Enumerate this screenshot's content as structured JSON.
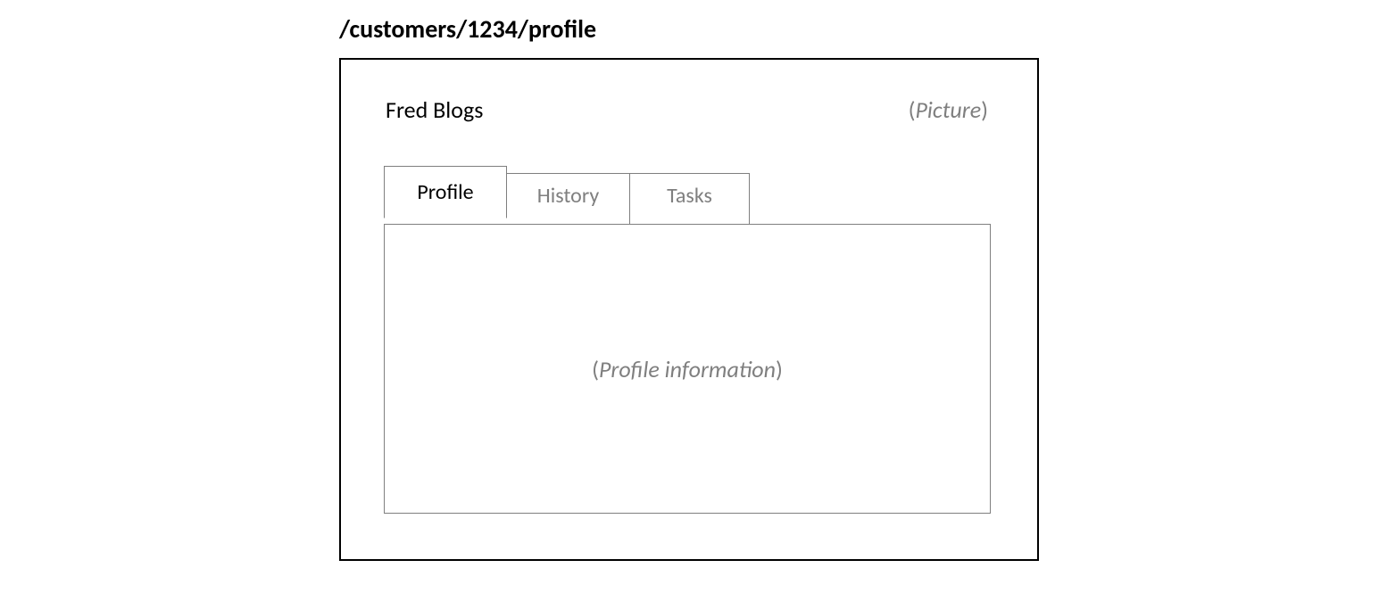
{
  "url_path": "/customers/1234/profile",
  "customer_name": "Fred Blogs",
  "picture_label": "Picture",
  "tabs": {
    "profile": "Profile",
    "history": "History",
    "tasks": "Tasks"
  },
  "content_label": "Profile information"
}
